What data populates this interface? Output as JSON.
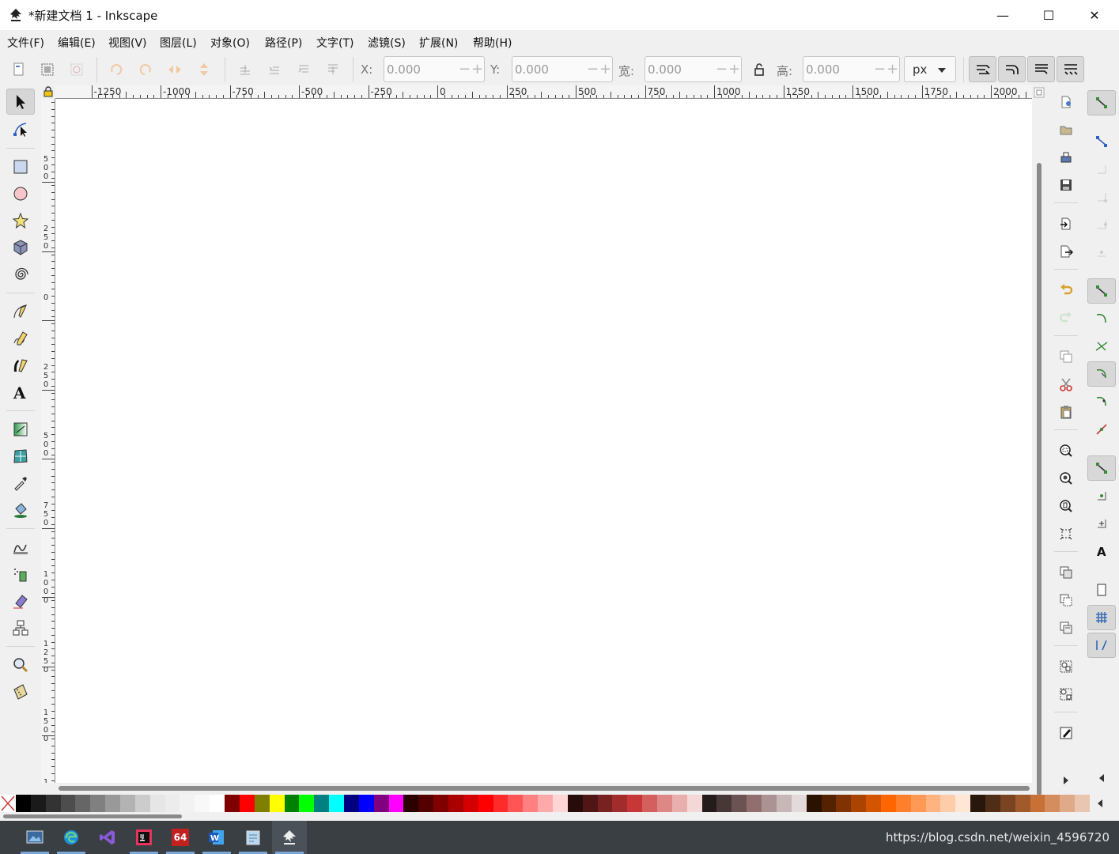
{
  "window": {
    "title": "*新建文档 1 - Inkscape",
    "minimize_glyph": "—",
    "maximize_glyph": "☐",
    "close_glyph": "✕"
  },
  "menu": [
    {
      "label": "文件(F)"
    },
    {
      "label": "编辑(E)"
    },
    {
      "label": "视图(V)"
    },
    {
      "label": "图层(L)"
    },
    {
      "label": "对象(O)"
    },
    {
      "label": "路径(P)"
    },
    {
      "label": "文字(T)"
    },
    {
      "label": "滤镜(S)"
    },
    {
      "label": "扩展(N)"
    },
    {
      "label": "帮助(H)"
    }
  ],
  "toolbar": {
    "x_label": "X:",
    "x_value": "0.000",
    "y_label": "Y:",
    "y_value": "0.000",
    "w_label": "宽:",
    "w_value": "0.000",
    "h_label": "高:",
    "h_value": "0.000",
    "unit": "px",
    "minus": "−",
    "plus": "+"
  },
  "ruler": {
    "h_labels": [
      "-1250",
      "-1000",
      "-750",
      "-500",
      "-250",
      "0",
      "250",
      "500",
      "750",
      "1000",
      "1250",
      "1500",
      "1750",
      "2000"
    ],
    "v_labels": [
      "5 0 0",
      "2 5 0",
      "0",
      "2 5 0",
      "5 0 0",
      "7 5 0",
      "1 0 0 0",
      "1 2 5 0",
      "1 5 0 0",
      "1"
    ]
  },
  "tools": [
    "selector-tool",
    "node-tool",
    "rect-tool",
    "ellipse-tool",
    "star-tool",
    "3dbox-tool",
    "spiral-tool",
    "pen-tool",
    "pencil-tool",
    "calligraphy-tool",
    "text-tool",
    "gradient-tool",
    "mesh-tool",
    "dropper-tool",
    "paint-bucket-tool",
    "tweak-tool",
    "spray-tool",
    "eraser-tool",
    "connector-tool",
    "zoom-tool",
    "measure-tool"
  ],
  "colors": {
    "accent": "#2a5db0",
    "taskbar": "#3a3f44"
  },
  "palette": [
    "#000000",
    "#1a1a1a",
    "#333333",
    "#4d4d4d",
    "#666666",
    "#808080",
    "#999999",
    "#b3b3b3",
    "#cccccc",
    "#e6e6e6",
    "#ececec",
    "#f2f2f2",
    "#f8f8f8",
    "#ffffff",
    "#800000",
    "#ff0000",
    "#808000",
    "#ffff00",
    "#008000",
    "#00ff00",
    "#008080",
    "#00ffff",
    "#000080",
    "#0000ff",
    "#800080",
    "#ff00ff",
    "#2b0000",
    "#550000",
    "#800000",
    "#aa0000",
    "#d40000",
    "#ff0000",
    "#ff2a2a",
    "#ff5555",
    "#ff8080",
    "#ffaaaa",
    "#ffd5d5",
    "#280b0b",
    "#501616",
    "#782121",
    "#a02c2c",
    "#c83737",
    "#d35f5f",
    "#de8787",
    "#e9afaf",
    "#f4d7d7",
    "#241c1c",
    "#483737",
    "#6c5353",
    "#916f6f",
    "#ac9393",
    "#c8b7b7",
    "#e3dbdb",
    "#2b1100",
    "#552200",
    "#803300",
    "#aa4400",
    "#d45500",
    "#ff6600",
    "#ff7f2a",
    "#ff9955",
    "#ffb380",
    "#ffccaa",
    "#ffe6d5",
    "#28170b",
    "#502d16",
    "#784421",
    "#a05a2c",
    "#c87137",
    "#d38d5f",
    "#deaa87",
    "#e9c6af"
  ],
  "taskbar": {
    "watermark": "https://blog.csdn.net/weixin_4596720",
    "apps": [
      "photos-app",
      "edge-app",
      "visual-studio-app",
      "intellij-app",
      "sixty-four-app",
      "word-app",
      "notepad-app",
      "inkscape-app"
    ],
    "sixty_four_label": "64"
  }
}
